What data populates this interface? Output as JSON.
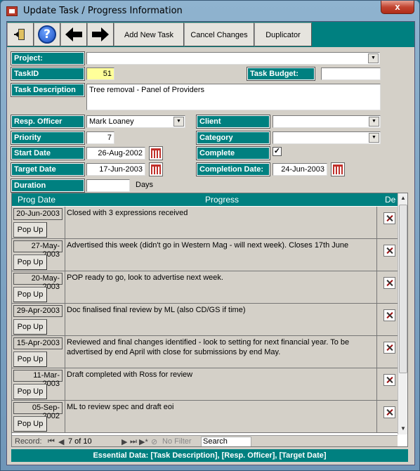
{
  "window": {
    "title": "Update Task / Progress Information",
    "close": "x"
  },
  "toolbar": {
    "add_label": "Add New Task",
    "cancel_label": "Cancel Changes",
    "dup_label": "Duplicator"
  },
  "form": {
    "project": {
      "label": "Project:",
      "value": ""
    },
    "task_id": {
      "label": "TaskID",
      "value": "51"
    },
    "task_budget": {
      "label": "Task Budget:",
      "value": ""
    },
    "task_description": {
      "label": "Task Description",
      "value": "Tree removal - Panel of Providers"
    },
    "resp_officer": {
      "label": "Resp. Officer",
      "value": "Mark Loaney"
    },
    "client": {
      "label": "Client",
      "value": ""
    },
    "priority": {
      "label": "Priority",
      "value": "7"
    },
    "category": {
      "label": "Category",
      "value": ""
    },
    "start_date": {
      "label": "Start Date",
      "value": "26-Aug-2002"
    },
    "complete": {
      "label": "Complete",
      "checked": true,
      "mark": "✓"
    },
    "target_date": {
      "label": "Target Date",
      "value": "17-Jun-2003"
    },
    "completion_date": {
      "label": "Completion Date:",
      "value": "24-Jun-2003"
    },
    "duration": {
      "label": "Duration",
      "value": "",
      "unit": "Days"
    }
  },
  "progress": {
    "headers": {
      "date": "Prog Date",
      "progress": "Progress",
      "del": "De"
    },
    "popup_label": "Pop Up",
    "rows": [
      {
        "date": "20-Jun-2003",
        "text": "Closed with 3 expressions received"
      },
      {
        "date": "27-May-2003",
        "text": "Advertised this week (didn't go in Western Mag - will next week). Closes 17th June"
      },
      {
        "date": "20-May-2003",
        "text": "POP ready to go, look to advertise next week."
      },
      {
        "date": "29-Apr-2003",
        "text": "Doc finalised final review by ML (also CD/GS if time)"
      },
      {
        "date": "15-Apr-2003",
        "text": "Reviewed and final changes identified - look to setting for next financial year. To be advertised by end April with close for submissions by end May."
      },
      {
        "date": "11-Mar-2003",
        "text": "Draft completed with Ross for review"
      },
      {
        "date": "05-Sep-2002",
        "text": "ML to review spec and draft eoi"
      }
    ]
  },
  "navigation": {
    "record_label": "Record:",
    "record_value": "7 of 10",
    "filter_label": "No Filter",
    "search_label": "Search"
  },
  "footer": {
    "text": "Essential Data: [Task Description], [Resp. Officer], [Target Date]"
  }
}
